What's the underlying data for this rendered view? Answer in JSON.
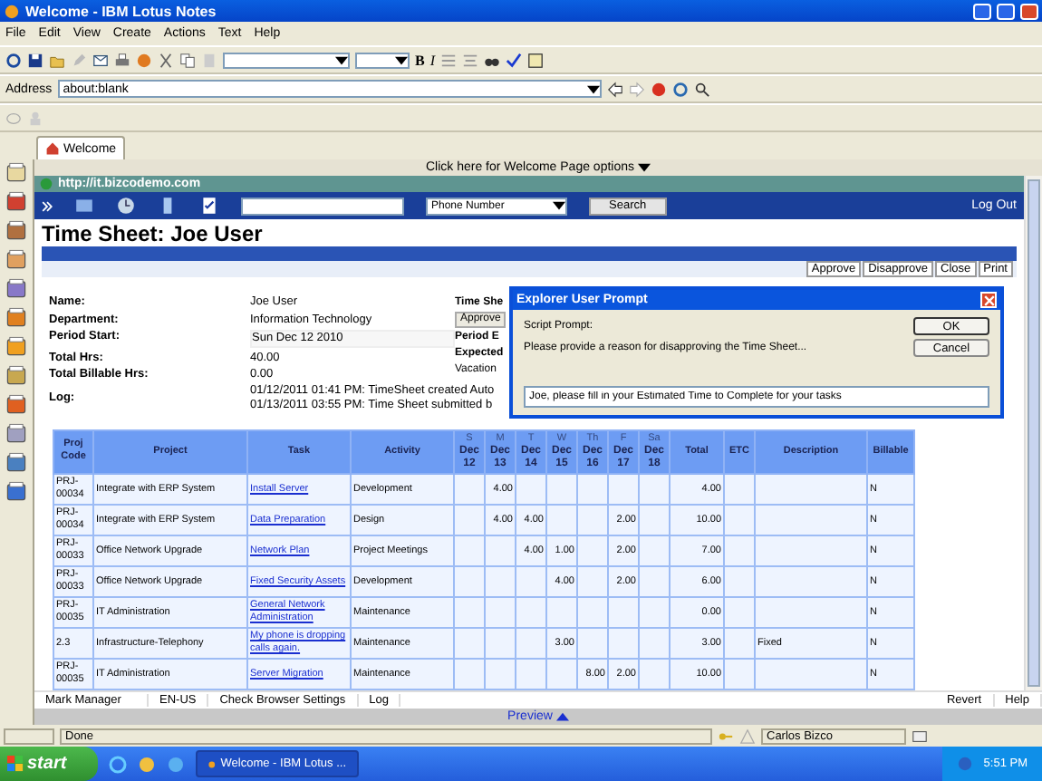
{
  "window": {
    "title": "Welcome - IBM Lotus Notes"
  },
  "menu": [
    "File",
    "Edit",
    "View",
    "Create",
    "Actions",
    "Text",
    "Help"
  ],
  "toolbar": {
    "format_buttons": [
      "B",
      "I"
    ]
  },
  "address": {
    "label": "Address",
    "value": "about:blank"
  },
  "tabs": [
    {
      "label": "Welcome",
      "selected": true
    }
  ],
  "welcome_options": "Click here for Welcome Page options",
  "page": {
    "url": "http://it.bizcodemo.com",
    "search_select": "Phone Number",
    "search_button": "Search",
    "logout": "Log Out",
    "title": "Time Sheet: Joe User",
    "actions": [
      "Approve",
      "Disapprove",
      "Close",
      "Print"
    ],
    "fields": [
      {
        "label": "Name:",
        "value": "Joe User",
        "kind": "text"
      },
      {
        "label": "Department:",
        "value": "Information Technology",
        "kind": "text"
      },
      {
        "label": "Period Start:",
        "value": "Sun Dec 12 2010",
        "kind": "input"
      },
      {
        "label": "Total Hrs:",
        "value": "40.00",
        "kind": "text"
      },
      {
        "label": "Total Billable Hrs:",
        "value": "0.00",
        "kind": "text"
      }
    ],
    "log": {
      "label": "Log:",
      "lines": [
        "01/12/2011 01:41 PM: TimeSheet created Auto",
        "01/13/2011 03:55 PM: Time Sheet submitted b"
      ]
    },
    "side_fields": [
      {
        "kind": "label",
        "text": "Time She"
      },
      {
        "kind": "button",
        "text": "Approve"
      },
      {
        "kind": "label",
        "text": "Period E"
      },
      {
        "kind": "label",
        "text": "Expected"
      },
      {
        "kind": "value",
        "text": "Vacation"
      }
    ],
    "table": {
      "columns": [
        {
          "label": "Proj Code",
          "kind": "text"
        },
        {
          "label": "Project",
          "kind": "text"
        },
        {
          "label": "Task",
          "kind": "link"
        },
        {
          "label": "Activity",
          "kind": "text"
        },
        {
          "day": "S",
          "label": "Dec 12",
          "kind": "number"
        },
        {
          "day": "M",
          "label": "Dec 13",
          "kind": "number"
        },
        {
          "day": "T",
          "label": "Dec 14",
          "kind": "number"
        },
        {
          "day": "W",
          "label": "Dec 15",
          "kind": "number"
        },
        {
          "day": "Th",
          "label": "Dec 16",
          "kind": "number"
        },
        {
          "day": "F",
          "label": "Dec 17",
          "kind": "number"
        },
        {
          "day": "Sa",
          "label": "Dec 18",
          "kind": "number"
        },
        {
          "label": "Total",
          "kind": "number"
        },
        {
          "label": "ETC",
          "kind": "number"
        },
        {
          "label": "Description",
          "kind": "text"
        },
        {
          "label": "Billable",
          "kind": "text"
        }
      ],
      "rows": [
        [
          "PRJ-00034",
          "Integrate with ERP System",
          "Install Server",
          "Development",
          null,
          "4.00",
          null,
          null,
          null,
          null,
          null,
          "4.00",
          null,
          null,
          "N"
        ],
        [
          "PRJ-00034",
          "Integrate with ERP System",
          "Data Preparation",
          "Design",
          null,
          "4.00",
          "4.00",
          null,
          null,
          "2.00",
          null,
          "10.00",
          null,
          null,
          "N"
        ],
        [
          "PRJ-00033",
          "Office Network Upgrade",
          "Network Plan",
          "Project Meetings",
          null,
          null,
          "4.00",
          "1.00",
          null,
          "2.00",
          null,
          "7.00",
          null,
          null,
          "N"
        ],
        [
          "PRJ-00033",
          "Office Network Upgrade",
          "Fixed Security Assets",
          "Development",
          null,
          null,
          null,
          "4.00",
          null,
          "2.00",
          null,
          "6.00",
          null,
          null,
          "N"
        ],
        [
          "PRJ-00035",
          "IT Administration",
          "General Network Administration",
          "Maintenance",
          null,
          null,
          null,
          null,
          null,
          null,
          null,
          "0.00",
          null,
          null,
          "N"
        ],
        [
          "2.3",
          "Infrastructure-Telephony",
          "My phone is dropping calls again.",
          "Maintenance",
          null,
          null,
          null,
          "3.00",
          null,
          null,
          null,
          "3.00",
          null,
          "Fixed",
          "N"
        ],
        [
          "PRJ-00035",
          "IT Administration",
          "Server Migration",
          "Maintenance",
          null,
          null,
          null,
          null,
          "8.00",
          "2.00",
          null,
          "10.00",
          null,
          null,
          "N"
        ]
      ]
    }
  },
  "bottom_bar": {
    "left": [
      "Mark Manager",
      "EN-US",
      "Check Browser Settings",
      "Log"
    ],
    "right": [
      "Revert",
      "Help"
    ]
  },
  "preview": "Preview",
  "dialog": {
    "title": "Explorer User Prompt",
    "label": "Script Prompt:",
    "message": "Please provide a reason for disapproving the Time Sheet...",
    "value": "Joe, please fill in your Estimated Time to Complete for your tasks",
    "buttons": [
      {
        "label": "OK",
        "selected": true
      },
      {
        "label": "Cancel",
        "selected": false
      }
    ]
  },
  "status_bar": {
    "message": "Done",
    "user": "Carlos Bizco"
  },
  "taskbar": {
    "start": "start",
    "task": "Welcome - IBM Lotus ...",
    "clock": "5:51 PM"
  }
}
